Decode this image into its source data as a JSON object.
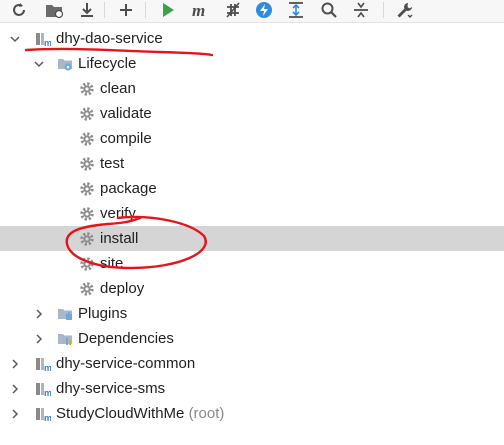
{
  "toolbar": {
    "buttons": [
      {
        "name": "reload-icon"
      },
      {
        "name": "generate-sources-icon"
      },
      {
        "name": "download-icon"
      },
      {
        "name": "add-icon"
      },
      {
        "name": "run-icon"
      },
      {
        "name": "maven-goal-icon"
      },
      {
        "name": "skip-tests-icon"
      },
      {
        "name": "offline-mode-icon"
      },
      {
        "name": "show-dependencies-icon"
      },
      {
        "name": "find-icon"
      },
      {
        "name": "collapse-all-icon"
      },
      {
        "name": "settings-wrench-icon"
      }
    ]
  },
  "tree": {
    "dao_service": "dhy-dao-service",
    "lifecycle": "Lifecycle",
    "goals": [
      "clean",
      "validate",
      "compile",
      "test",
      "package",
      "verify",
      "install",
      "site",
      "deploy"
    ],
    "plugins": "Plugins",
    "dependencies": "Dependencies",
    "common": "dhy-service-common",
    "sms": "dhy-service-sms",
    "root_name": "StudyCloudWithMe",
    "root_suffix": "(root)"
  },
  "selected_goal": "install",
  "colors": {
    "selection": "#d5d5d5",
    "annotation": "#e5141b",
    "gear": "#8c8c8c",
    "folder": "#a9b7c6",
    "run": "#3aa34a",
    "lightning": "#2f8ae0"
  }
}
